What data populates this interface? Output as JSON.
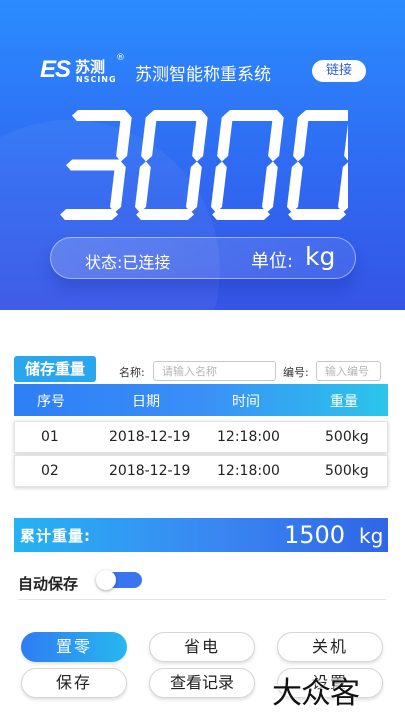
{
  "header": {
    "logo": {
      "mark": "ES",
      "cn": "苏测",
      "en": "NSCING",
      "reg": "®"
    },
    "title": "苏测智能称重系统",
    "connect_button": "链接",
    "display_value": "3000",
    "status": "状态:已连接",
    "unit_label": "单位:",
    "unit_value": "kg"
  },
  "storage": {
    "title": "储存重量",
    "name_label": "名称:",
    "name_placeholder": "请输入名称",
    "code_label": "编号:",
    "code_placeholder": "输入编号",
    "columns": [
      "序号",
      "日期",
      "时间",
      "重量"
    ],
    "rows": [
      {
        "index": "01",
        "date": "2018-12-19",
        "time": "12:18:00",
        "weight": "500kg"
      },
      {
        "index": "02",
        "date": "2018-12-19",
        "time": "12:18:00",
        "weight": "500kg"
      }
    ]
  },
  "total": {
    "label": "累计重量:",
    "value": "1500",
    "unit": "kg"
  },
  "autosave": {
    "label": "自动保存",
    "enabled": false
  },
  "buttons": {
    "zero": "置零",
    "power_save": "省电",
    "shutdown": "关机",
    "save": "保存",
    "records": "查看记录",
    "settings": "设置"
  },
  "watermark": "大众客",
  "colors": {
    "primary": "#2f6af2",
    "accent": "#27b7ee"
  }
}
